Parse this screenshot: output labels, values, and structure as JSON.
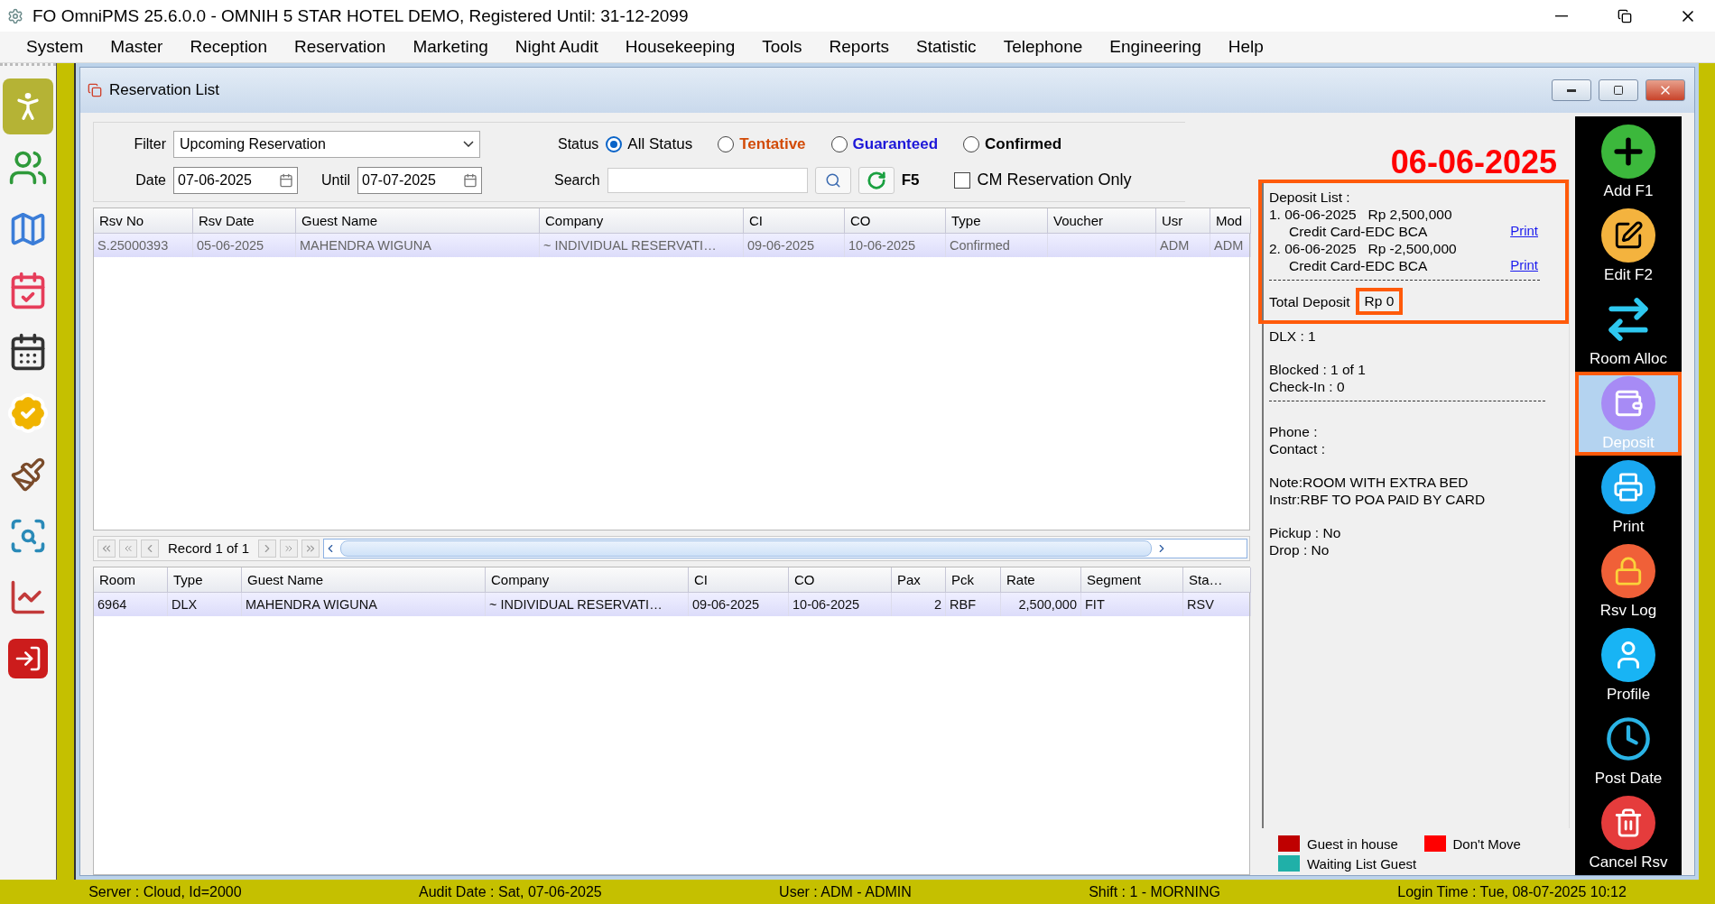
{
  "app": {
    "title": "FO OmniPMS 25.6.0.0 - OMNIH 5 STAR HOTEL DEMO, Registered Until: 31-12-2099"
  },
  "menu": [
    "System",
    "Master",
    "Reception",
    "Reservation",
    "Marketing",
    "Night Audit",
    "Housekeeping",
    "Tools",
    "Reports",
    "Statistic",
    "Telephone",
    "Engineering",
    "Help"
  ],
  "sidebar": [
    {
      "selected": true
    },
    {
      "selected": false
    },
    {
      "selected": false
    },
    {
      "selected": false
    },
    {
      "selected": false
    },
    {
      "selected": false
    },
    {
      "selected": false
    },
    {
      "selected": false
    },
    {
      "selected": false
    },
    {
      "selected": false
    }
  ],
  "window": {
    "title": "Reservation List"
  },
  "filters": {
    "filter": {
      "label": "Filter",
      "value": "Upcoming Reservation"
    },
    "date": {
      "label": "Date",
      "value": "07-06-2025"
    },
    "until": {
      "label": "Until",
      "value": "07-07-2025"
    },
    "status": {
      "label": "Status",
      "options": [
        {
          "label": "All Status",
          "selected": true,
          "color": "#000000"
        },
        {
          "label": "Tentative",
          "selected": false,
          "color": "#d24a06"
        },
        {
          "label": "Guaranteed",
          "selected": false,
          "color": "#1c16d8"
        },
        {
          "label": "Confirmed",
          "selected": false,
          "color": "#000000"
        }
      ]
    },
    "search": {
      "label": "Search"
    },
    "refresh": {
      "label": "F5"
    },
    "cm_only": {
      "label": "CM Reservation Only",
      "checked": false
    }
  },
  "reservations": {
    "columns": [
      "Rsv No",
      "Rsv Date",
      "Guest Name",
      "Company",
      "CI",
      "CO",
      "Type",
      "Voucher",
      "Usr",
      "Mod"
    ],
    "rows": [
      {
        "selected": true,
        "cells": [
          "S.25000393",
          "05-06-2025",
          "MAHENDRA WIGUNA",
          "~ INDIVIDUAL RESERVATI…",
          "09-06-2025",
          "10-06-2025",
          "Confirmed",
          "",
          "ADM",
          "ADM"
        ]
      }
    ]
  },
  "pager": {
    "text": "Record 1 of 1"
  },
  "rooms": {
    "columns": [
      "Room",
      "Type",
      "Guest Name",
      "Company",
      "CI",
      "CO",
      "Pax",
      "Pck",
      "Rate",
      "Segment",
      "Sta…"
    ],
    "rows": [
      {
        "selected": true,
        "cells": [
          "6964",
          "DLX",
          "MAHENDRA WIGUNA",
          "~ INDIVIDUAL RESERVATI…",
          "09-06-2025",
          "10-06-2025",
          "2",
          "RBF",
          "2,500,000",
          "FIT",
          "RSV"
        ]
      }
    ]
  },
  "info": {
    "date": "06-06-2025",
    "deposit": {
      "highlighted": true,
      "title": "Deposit List :",
      "entries": [
        {
          "line": "1. 06-06-2025   Rp 2,500,000",
          "method": "Credit Card-EDC BCA",
          "link": "Print"
        },
        {
          "line": "2. 06-06-2025   Rp -2,500,000",
          "method": "Credit Card-EDC BCA",
          "link": "Print"
        }
      ],
      "total_label": "Total Deposit",
      "total_value": "Rp 0",
      "total_highlighted": true
    },
    "sections": [
      {
        "lines": [
          "DLX : 1"
        ],
        "rule_after": false
      },
      {
        "lines": [
          "Blocked : 1 of 1",
          "Check-In : 0"
        ],
        "rule_after": true
      },
      {
        "lines": [
          "Phone :",
          "Contact :"
        ],
        "rule_after": false
      },
      {
        "lines": [
          "Note:ROOM WITH EXTRA BED",
          "Instr:RBF TO POA PAID BY CARD"
        ],
        "rule_after": false
      },
      {
        "lines": [
          "Pickup : No",
          "Drop : No"
        ],
        "rule_after": false
      }
    ],
    "legend": [
      {
        "label": "Guest in house",
        "color": "#bf0000"
      },
      {
        "label": "Don't Move",
        "color": "#ff0000"
      },
      {
        "label": "Waiting List Guest",
        "color": "#20b0a8"
      }
    ]
  },
  "toolbar": [
    {
      "label": "Add F1",
      "selected": false,
      "highlighted": false
    },
    {
      "label": "Edit F2",
      "selected": false,
      "highlighted": false
    },
    {
      "label": "Room Alloc",
      "selected": false,
      "highlighted": false
    },
    {
      "label": "Deposit",
      "selected": true,
      "highlighted": true
    },
    {
      "label": "Print",
      "selected": false,
      "highlighted": false
    },
    {
      "label": "Rsv Log",
      "selected": false,
      "highlighted": false
    },
    {
      "label": "Profile",
      "selected": false,
      "highlighted": false
    },
    {
      "label": "Post Date",
      "selected": false,
      "highlighted": false
    },
    {
      "label": "Cancel Rsv",
      "selected": false,
      "highlighted": false
    }
  ],
  "status_bar": [
    "Server : Cloud, Id=2000",
    "Audit Date : Sat, 07-06-2025",
    "User : ADM - ADMIN",
    "Shift : 1 - MORNING",
    "Login Time : Tue, 08-07-2025 10:12"
  ]
}
